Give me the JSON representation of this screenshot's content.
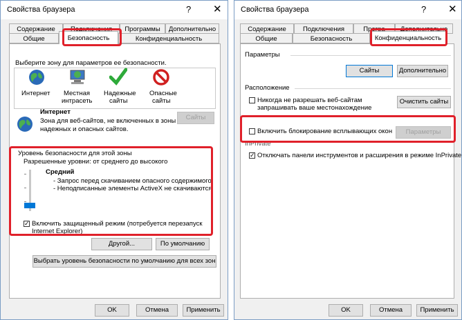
{
  "left": {
    "title": "Свойства браузера",
    "help": "?",
    "close": "✕",
    "tabs_back": [
      "Содержание",
      "Подключения",
      "Программы",
      "Дополнительно"
    ],
    "tabs_front": [
      "Общие",
      "Безопасность",
      "Конфиденциальность"
    ],
    "zone_prompt": "Выберите зону для параметров ее безопасности.",
    "zones": [
      {
        "label1": "Интернет",
        "label2": "",
        "icon": "globe-icon"
      },
      {
        "label1": "Местная",
        "label2": "интрасеть",
        "icon": "intranet-icon"
      },
      {
        "label1": "Надежные",
        "label2": "сайты",
        "icon": "checkmark-icon"
      },
      {
        "label1": "Опасные",
        "label2": "сайты",
        "icon": "restricted-icon"
      }
    ],
    "zone_title": "Интернет",
    "zone_desc1": "Зона для веб-сайтов, не включенных в зоны",
    "zone_desc2": "надежных и опасных сайтов.",
    "sites_btn": "Сайты",
    "level_group": "Уровень безопасности для этой зоны",
    "allowed_levels": "Разрешенные уровни: от среднего до высокого",
    "level_name": "Средний",
    "level_line1": "- Запрос перед скачиванием опасного содержимого",
    "level_line2": "- Неподписанные элементы ActiveX не скачиваются",
    "slider_level": 0.33,
    "protected_mode1": "Включить защищенный режим (потребуется перезапуск",
    "protected_mode2": "Internet Explorer)",
    "protected_checked": "✓",
    "custom_btn": "Другой...",
    "default_btn": "По умолчанию",
    "reset_all_btn": "Выбрать уровень безопасности по умолчанию для всех зон",
    "ok": "OK",
    "cancel": "Отмена",
    "apply": "Применить"
  },
  "right": {
    "title": "Свойства браузера",
    "help": "?",
    "close": "✕",
    "tabs_back": [
      "Содержание",
      "Подключения",
      "Програ",
      "Дополнительно"
    ],
    "tabs_front": [
      "Общие",
      "Безопасность",
      "Конфиденциальность"
    ],
    "params_header": "Параметры",
    "sites_btn": "Сайты",
    "advanced_btn": "Дополнительно",
    "location_header": "Расположение",
    "location_text1": "Никогда не разрешать веб-сайтам",
    "location_text2": "запрашивать ваше местонахождение",
    "clear_sites_btn": "Очистить сайты",
    "popup_text": "Включить блокирование всплывающих окон",
    "popup_params_btn": "Параметры",
    "inprivate_header": "InPrivate",
    "inprivate_text": "Отключать панели инструментов и расширения в режиме InPrivate",
    "inprivate_checked": "✓",
    "ok": "OK",
    "cancel": "Отмена",
    "apply": "Применить"
  }
}
